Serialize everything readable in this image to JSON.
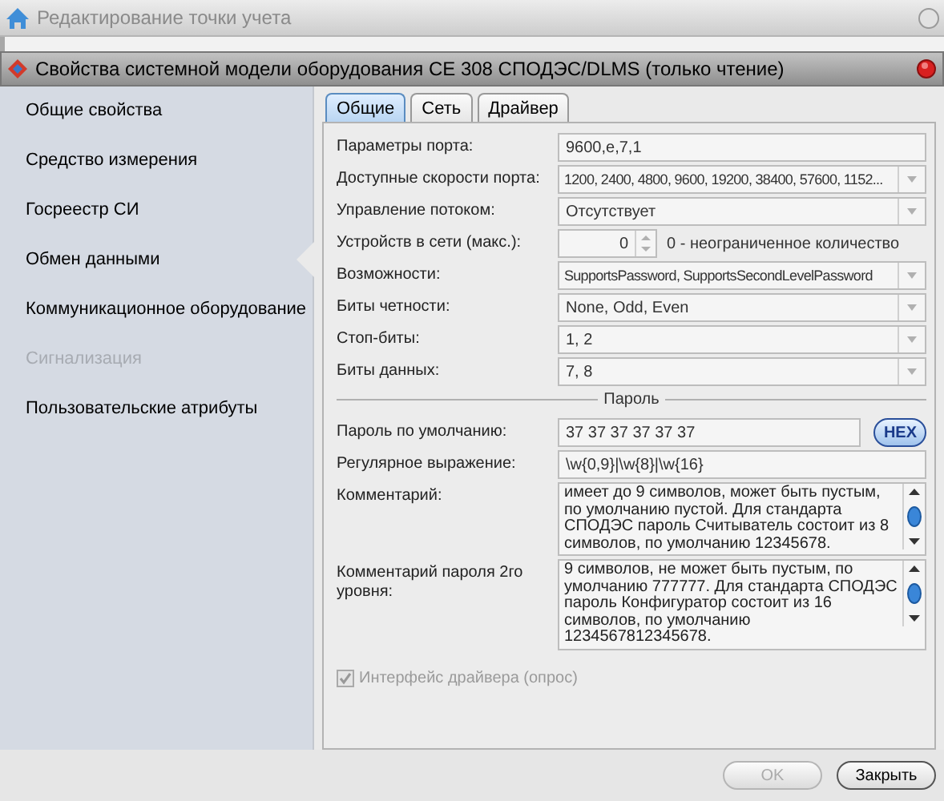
{
  "outer_window": {
    "title": "Редактирование точки учета"
  },
  "dialog": {
    "title": "Свойства системной модели оборудования CE 308 СПОДЭС/DLMS (только чтение)"
  },
  "sidebar": {
    "items": [
      {
        "label": "Общие свойства",
        "selected": false,
        "disabled": false
      },
      {
        "label": "Средство измерения",
        "selected": false,
        "disabled": false
      },
      {
        "label": "Госреестр СИ",
        "selected": false,
        "disabled": false
      },
      {
        "label": "Обмен данными",
        "selected": true,
        "disabled": false
      },
      {
        "label": "Коммуникационное оборудование",
        "selected": false,
        "disabled": false
      },
      {
        "label": "Сигнализация",
        "selected": false,
        "disabled": true
      },
      {
        "label": "Пользовательские атрибуты",
        "selected": false,
        "disabled": false
      }
    ]
  },
  "tabs": [
    {
      "label": "Общие",
      "selected": true
    },
    {
      "label": "Сеть",
      "selected": false
    },
    {
      "label": "Драйвер",
      "selected": false
    }
  ],
  "fields": [
    {
      "kind": "text",
      "label": "Параметры порта:",
      "value": "9600,e,7,1"
    },
    {
      "kind": "dropdown",
      "label": "Доступные скорости порта:",
      "value": "1200, 2400, 4800, 9600, 19200, 38400, 57600, 1152..."
    },
    {
      "kind": "dropdown",
      "label": "Управление потоком:",
      "value": "Отсутствует"
    },
    {
      "kind": "spinner",
      "label": "Устройств в сети (макс.):",
      "value": "0",
      "note": "0 - неограниченное количество"
    },
    {
      "kind": "dropdown",
      "label": "Возможности:",
      "value": "SupportsPassword, SupportsSecondLevelPassword"
    },
    {
      "kind": "dropdown",
      "label": "Биты четности:",
      "value": "None, Odd, Even"
    },
    {
      "kind": "dropdown",
      "label": "Стоп-биты:",
      "value": "1, 2"
    },
    {
      "kind": "dropdown",
      "label": "Биты данных:",
      "value": "7, 8"
    }
  ],
  "password_section": {
    "title": "Пароль",
    "fields": [
      {
        "kind": "hex",
        "label": "Пароль по умолчанию:",
        "value": "37 37 37 37 37 37",
        "button": "HEX"
      },
      {
        "kind": "text",
        "label": "Регулярное выражение:",
        "value": "\\w{0,9}|\\w{8}|\\w{16}"
      },
      {
        "kind": "memo",
        "label": "Комментарий:",
        "value": "имеет до 9 символов, может быть пустым, по умолчанию пустой. Для стандарта СПОДЭС пароль Считыватель состоит из 8 символов, по умолчанию 12345678."
      },
      {
        "kind": "memo",
        "label": "Комментарий пароля 2го уровня:",
        "value": "9 символов, не может быть пустым, по умолчанию 777777. Для стандарта СПОДЭС пароль Конфигуратор состоит из 16 символов, по умолчанию 1234567812345678."
      }
    ]
  },
  "driver_checkbox": {
    "label": "Интерфейс драйвера (опрос)",
    "checked": true,
    "disabled": true
  },
  "buttons": [
    {
      "label": "OK",
      "disabled": true
    },
    {
      "label": "Закрыть",
      "disabled": false
    }
  ]
}
